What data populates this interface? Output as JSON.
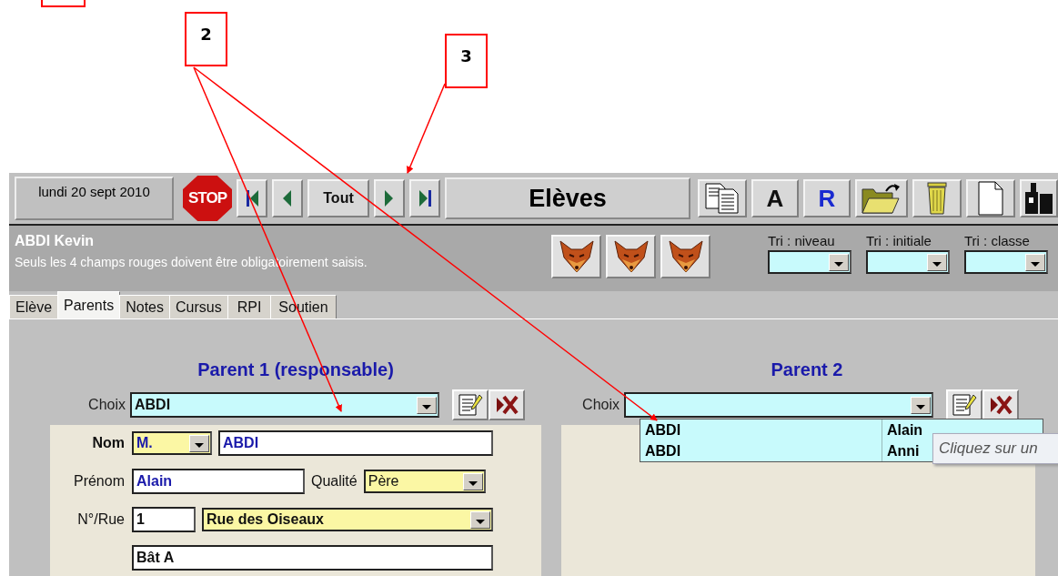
{
  "callouts": [
    {
      "label": "2"
    },
    {
      "label": "3"
    }
  ],
  "toolbar": {
    "date": "lundi 20 sept 2010",
    "buttons": [
      {
        "kind": "stop",
        "label": "STOP"
      },
      {
        "kind": "first"
      },
      {
        "kind": "prev"
      },
      {
        "kind": "text",
        "label": "Tout"
      },
      {
        "kind": "next"
      },
      {
        "kind": "last"
      }
    ],
    "title": "Elèves",
    "actions": [
      {
        "kind": "copy"
      },
      {
        "kind": "letter",
        "label": "A",
        "accent": false
      },
      {
        "kind": "letter",
        "label": "R",
        "accent": true
      },
      {
        "kind": "folder"
      },
      {
        "kind": "trash"
      },
      {
        "kind": "page"
      },
      {
        "kind": "binoculars"
      }
    ]
  },
  "header": {
    "student": "ABDI Kevin",
    "hint": "Seuls les 4 champs rouges doivent être obligatoirement saisis.",
    "fox_buttons": [
      {
        "kind": "fox"
      },
      {
        "kind": "fox"
      },
      {
        "kind": "fox"
      }
    ],
    "sorts": [
      {
        "label": "Tri : niveau"
      },
      {
        "label": "Tri : initiale"
      },
      {
        "label": "Tri : classe"
      }
    ]
  },
  "tabs": [
    {
      "label": "Elève",
      "selected": false
    },
    {
      "label": "Parents",
      "selected": true
    },
    {
      "label": "Notes",
      "selected": false
    },
    {
      "label": "Cursus",
      "selected": false
    },
    {
      "label": "RPI",
      "selected": false
    },
    {
      "label": "Soutien",
      "selected": false
    }
  ],
  "parent1": {
    "heading": "Parent 1 (responsable)",
    "choice_label": "Choix",
    "choice_value": "ABDI",
    "rows": [
      {
        "label": "Nom",
        "emphasis": true,
        "fields": [
          {
            "kind": "combo",
            "value": "M.",
            "accent": true,
            "bold": true
          },
          {
            "kind": "text",
            "value": "ABDI",
            "accent": true,
            "bold": true
          }
        ]
      },
      {
        "label": "Prénom",
        "emphasis": false,
        "fields": [
          {
            "kind": "text",
            "value": "Alain",
            "accent": true,
            "bold": true
          },
          {
            "kind": "label",
            "value": "Qualité"
          },
          {
            "kind": "combo",
            "value": "Père",
            "accent": false,
            "bold": false
          }
        ]
      },
      {
        "label": "N°/Rue",
        "emphasis": false,
        "fields": [
          {
            "kind": "text",
            "value": "1",
            "accent": false,
            "bold": true
          },
          {
            "kind": "combo",
            "value": "Rue des Oiseaux",
            "accent": false,
            "bold": true
          }
        ]
      },
      {
        "fields": [
          {
            "kind": "text",
            "value": "Bât A",
            "accent": false,
            "bold": true
          }
        ]
      }
    ]
  },
  "parent2": {
    "heading": "Parent 2",
    "choice_label": "Choix",
    "dropdown": [
      {
        "name": "ABDI",
        "first_name": "Alain"
      },
      {
        "name": "ABDI",
        "first_name": "Anni"
      }
    ],
    "tooltip": "Cliquez sur un"
  }
}
